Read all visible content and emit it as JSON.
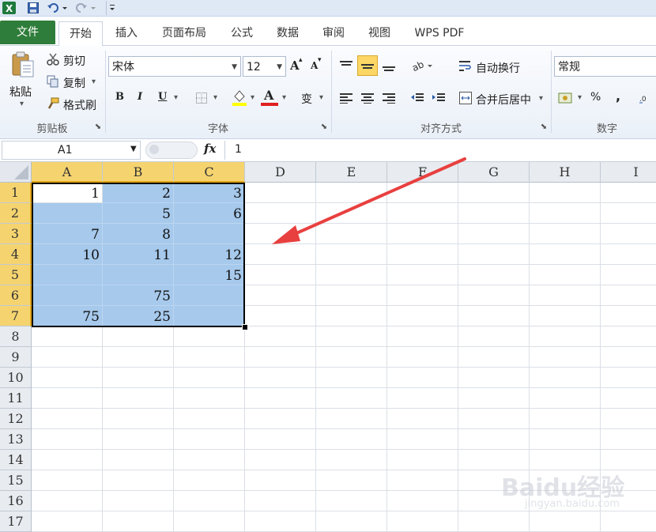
{
  "quick_access": {
    "app_icon": "excel-icon",
    "icons": [
      "save-icon",
      "undo-icon",
      "redo-icon",
      "customize-icon"
    ]
  },
  "tabs": [
    "文件",
    "开始",
    "插入",
    "页面布局",
    "公式",
    "数据",
    "审阅",
    "视图",
    "WPS PDF"
  ],
  "active_tab": "开始",
  "colors": {
    "file_tab": "#2f7d3a",
    "selection_fill": "#a6c9ec",
    "header_selected": "#f5d470",
    "arrow": "#e8403f"
  },
  "clipboard": {
    "paste": "粘贴",
    "cut": "剪切",
    "copy": "复制",
    "format_painter": "格式刷",
    "group_label": "剪贴板"
  },
  "font": {
    "name": "宋体",
    "size": "12",
    "grow_label": "A",
    "shrink_label": "A",
    "bold": "B",
    "italic": "I",
    "underline": "U",
    "font_color_label": "A",
    "phonetic_label": "变",
    "group_label": "字体"
  },
  "alignment": {
    "wrap_text": "自动换行",
    "merge_center": "合并后居中",
    "group_label": "对齐方式"
  },
  "number": {
    "format": "常规",
    "percent": "%",
    "comma": ",",
    "group_label": "数字"
  },
  "formula_bar": {
    "name_box": "A1",
    "fx": "fx",
    "value": "1"
  },
  "columns": [
    "A",
    "B",
    "C",
    "D",
    "E",
    "F",
    "G",
    "H",
    "I"
  ],
  "rows": [
    "1",
    "2",
    "3",
    "4",
    "5",
    "6",
    "7",
    "8",
    "9",
    "10",
    "11",
    "12",
    "13",
    "14",
    "15",
    "16",
    "17"
  ],
  "cells": [
    [
      "1",
      "2",
      "3"
    ],
    [
      "",
      "5",
      "6"
    ],
    [
      "7",
      "8",
      ""
    ],
    [
      "10",
      "11",
      "12"
    ],
    [
      "",
      "",
      "15"
    ],
    [
      "",
      "75",
      ""
    ],
    [
      "75",
      "25",
      ""
    ]
  ],
  "watermark": {
    "brand": "Baidu经验",
    "url": "jingyan.baidu.com"
  }
}
